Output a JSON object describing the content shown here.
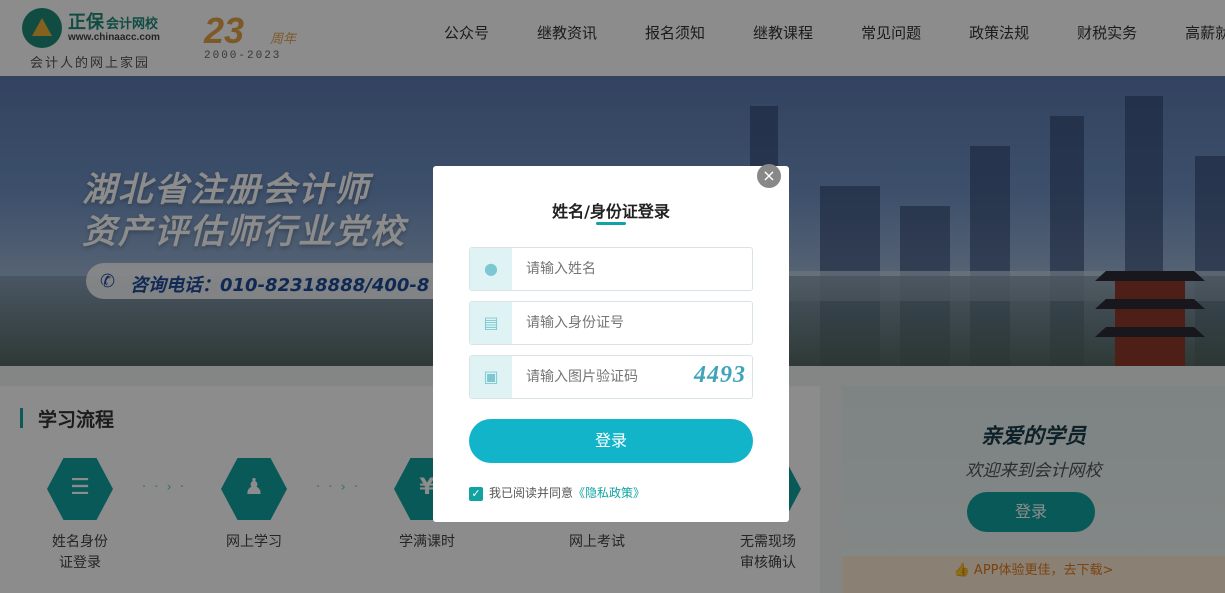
{
  "header": {
    "brand": "正保",
    "brand_sub": "会计网校",
    "url": "www.chinaacc.com",
    "slogan": "会计人的网上家园",
    "anniversary_num": "23",
    "anniversary_unit": "周年",
    "anniversary_years": "2000-2023",
    "nav": [
      "公众号",
      "继教资讯",
      "报名须知",
      "继教课程",
      "常见问题",
      "政策法规",
      "财税实务",
      "高薪就业"
    ]
  },
  "banner": {
    "line1": "湖北省注册会计师",
    "line2": "资产评估师行业党校",
    "phone": "咨询电话：010-82318888/400-8"
  },
  "process": {
    "title": "学习流程",
    "steps": [
      {
        "label": "姓名身份证登录",
        "icon": "clipboard-icon"
      },
      {
        "label": "网上学习",
        "icon": "user-check-icon"
      },
      {
        "label": "学满课时",
        "icon": "money-bag-icon"
      },
      {
        "label": "网上考试",
        "icon": "exam-icon"
      },
      {
        "label": "无需现场审核确认",
        "icon": "approve-icon"
      }
    ]
  },
  "welcome": {
    "title": "亲爱的学员",
    "subtitle": "欢迎来到会计网校",
    "login_label": "登录",
    "app_text": "APP体验更佳，去下载>"
  },
  "modal": {
    "title": "姓名/身份证登录",
    "name_placeholder": "请输入姓名",
    "id_placeholder": "请输入身份证号",
    "captcha_placeholder": "请输入图片验证码",
    "captcha_text": "4493",
    "login_label": "登录",
    "agree_text": "我已阅读并同意",
    "policy_link": "《隐私政策》",
    "close": "×"
  },
  "colors": {
    "accent": "#11a3a3",
    "login_button": "#11b4c8",
    "anniversary": "#e4a24a"
  }
}
